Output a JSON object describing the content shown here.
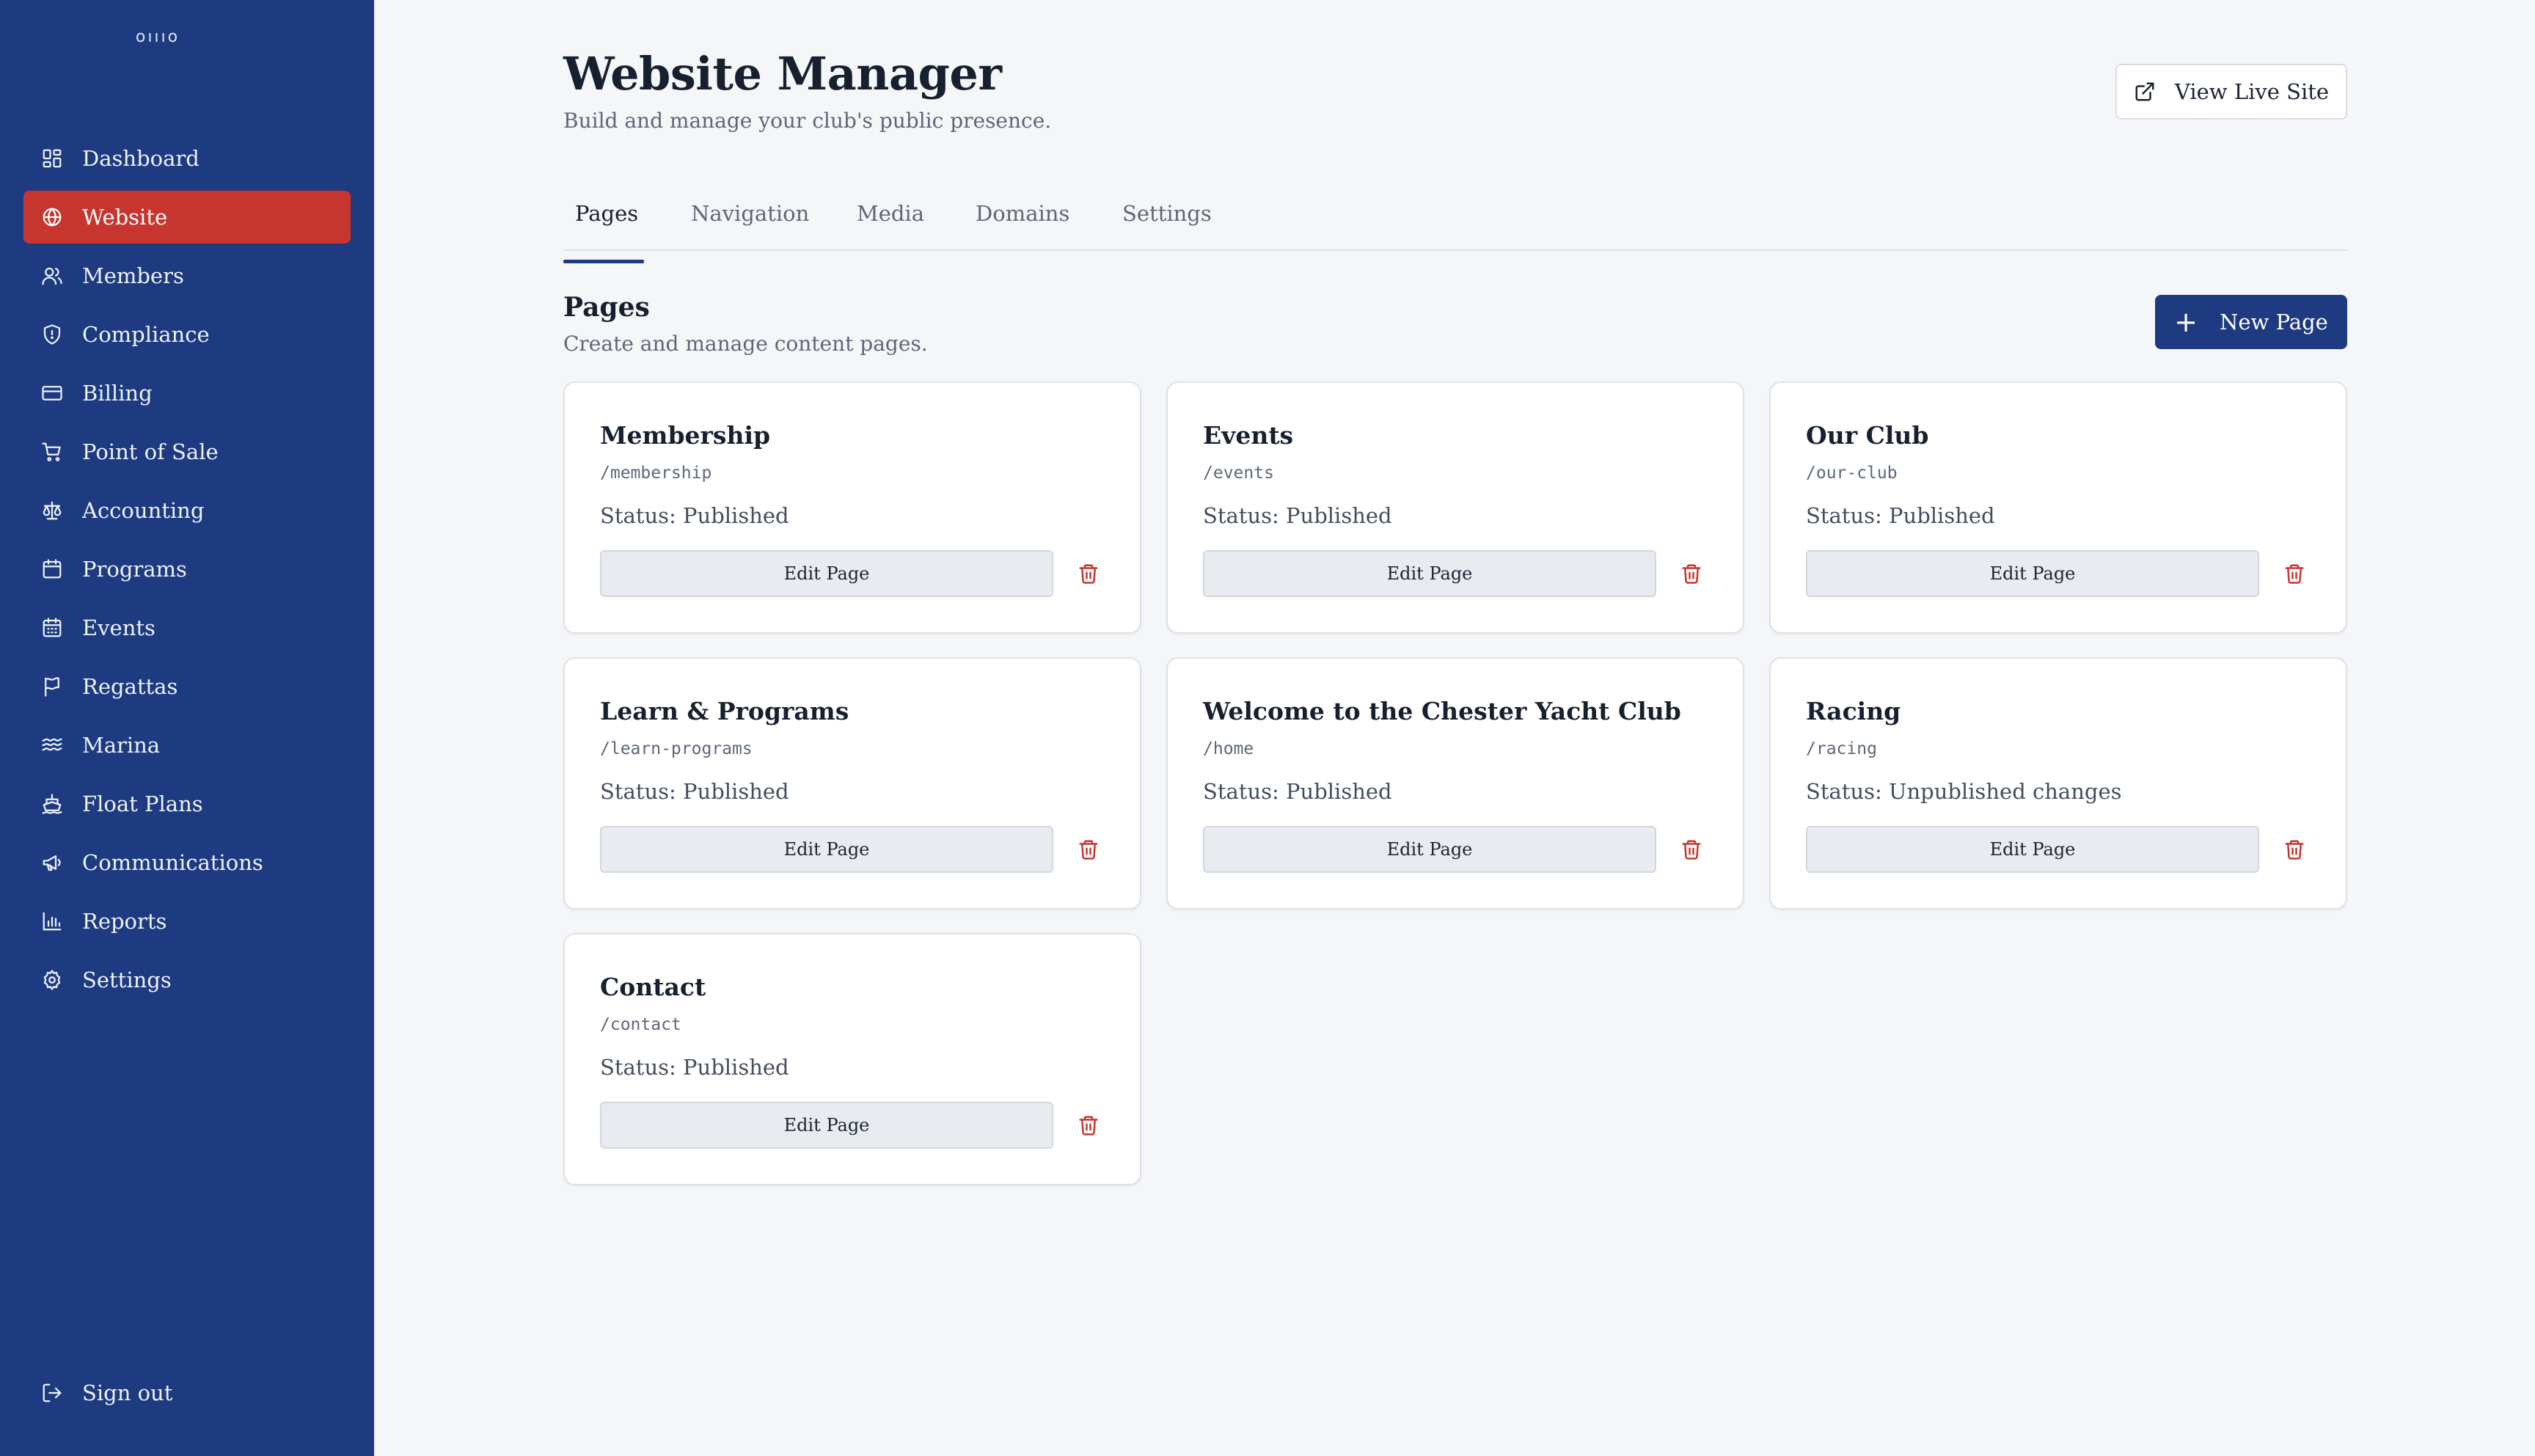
{
  "sidebar": {
    "logo_text": "oıııo",
    "items": [
      {
        "label": "Dashboard",
        "icon": "dashboard-icon"
      },
      {
        "label": "Website",
        "icon": "globe-icon",
        "active": true
      },
      {
        "label": "Members",
        "icon": "users-icon"
      },
      {
        "label": "Compliance",
        "icon": "shield-icon"
      },
      {
        "label": "Billing",
        "icon": "credit-card-icon"
      },
      {
        "label": "Point of Sale",
        "icon": "cart-icon"
      },
      {
        "label": "Accounting",
        "icon": "scale-icon"
      },
      {
        "label": "Programs",
        "icon": "calendar-icon"
      },
      {
        "label": "Events",
        "icon": "calendar-days-icon"
      },
      {
        "label": "Regattas",
        "icon": "flag-icon"
      },
      {
        "label": "Marina",
        "icon": "waves-icon"
      },
      {
        "label": "Float Plans",
        "icon": "ship-icon"
      },
      {
        "label": "Communications",
        "icon": "megaphone-icon"
      },
      {
        "label": "Reports",
        "icon": "bar-chart-icon"
      },
      {
        "label": "Settings",
        "icon": "gear-icon"
      }
    ],
    "signout_label": "Sign out"
  },
  "header": {
    "title": "Website Manager",
    "subtitle": "Build and manage your club's public presence.",
    "live_site_label": "View Live Site"
  },
  "tabs": [
    {
      "label": "Pages",
      "active": true
    },
    {
      "label": "Navigation"
    },
    {
      "label": "Media"
    },
    {
      "label": "Domains"
    },
    {
      "label": "Settings"
    }
  ],
  "section": {
    "title": "Pages",
    "subtitle": "Create and manage content pages.",
    "new_page_label": "New Page"
  },
  "pages": [
    {
      "title": "Membership",
      "slug": "/membership",
      "status": "Status: Published",
      "edit_label": "Edit Page"
    },
    {
      "title": "Events",
      "slug": "/events",
      "status": "Status: Published",
      "edit_label": "Edit Page"
    },
    {
      "title": "Our Club",
      "slug": "/our-club",
      "status": "Status: Published",
      "edit_label": "Edit Page"
    },
    {
      "title": "Learn & Programs",
      "slug": "/learn-programs",
      "status": "Status: Published",
      "edit_label": "Edit Page"
    },
    {
      "title": "Welcome to the Chester Yacht Club",
      "slug": "/home",
      "status": "Status: Published",
      "edit_label": "Edit Page"
    },
    {
      "title": "Racing",
      "slug": "/racing",
      "status": "Status: Unpublished changes",
      "edit_label": "Edit Page"
    },
    {
      "title": "Contact",
      "slug": "/contact",
      "status": "Status: Published",
      "edit_label": "Edit Page"
    }
  ],
  "colors": {
    "sidebar_bg": "#1e3a80",
    "active_nav": "#c7362e",
    "primary_button": "#1e3a80",
    "delete_icon": "#c7362e",
    "page_bg": "#f5f6f8"
  }
}
